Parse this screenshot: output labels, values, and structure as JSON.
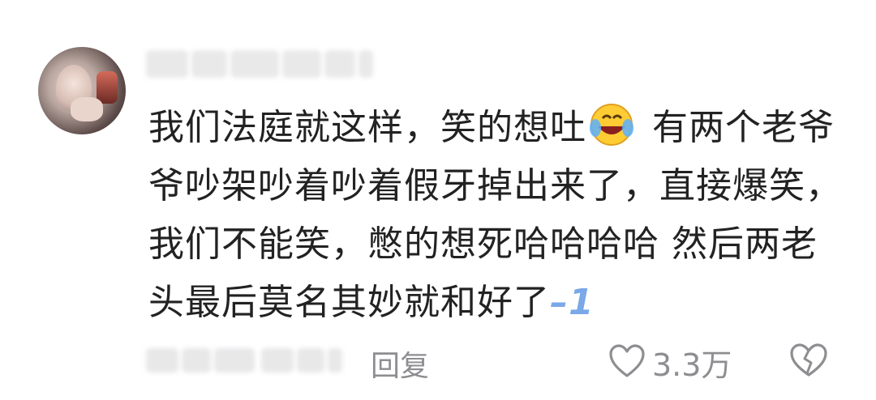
{
  "comment": {
    "text_line1a": "我们法庭就这样，笑的想吐",
    "text_line1b": " 有两个老",
    "text_rest": "爷爷吵架吵着吵着假牙掉出来了，直接爆笑，我们不能笑，憋的想死哈哈哈哈 然后两老头最后莫名其妙就和好了",
    "inline_mark": "–1",
    "emoji": "laughing-crying-emoji-icon"
  },
  "footer": {
    "reply_label": "回复",
    "like_count": "3.3万",
    "like_icon": "heart-outline-icon",
    "dislike_icon": "broken-heart-icon"
  },
  "colors": {
    "text": "#222222",
    "muted": "#8e8e92",
    "accent_mark": "#7aa8e8"
  }
}
